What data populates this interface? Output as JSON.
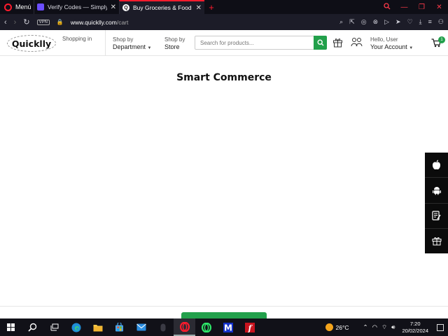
{
  "browser": {
    "menu_label": "Menú",
    "tabs": [
      {
        "title": "Verify Codes — SimplyCodes"
      },
      {
        "title": "Buy Groceries & Food Online"
      }
    ],
    "new_tab_symbol": "+",
    "url_host": "www.quicklly.com",
    "url_path": "/cart",
    "vpn_label": "VPN"
  },
  "site": {
    "logo_text": "Quicklly",
    "shopping_in_label": "Shopping in",
    "shop_by_department": {
      "top": "Shop by",
      "main": "Department"
    },
    "shop_by_store": {
      "top": "Shop by",
      "main": "Store"
    },
    "search": {
      "placeholder": "Search for products..."
    },
    "account": {
      "greeting": "Hello, User",
      "main": "Your Account"
    },
    "cart_count": "1",
    "page_title": "Smart Commerce"
  },
  "side_rail": {
    "items": [
      "apple-icon",
      "android-icon",
      "notepad-icon",
      "gift-icon"
    ]
  },
  "taskbar": {
    "temperature": "26°C",
    "time": "7:20",
    "date": "20/02/2024"
  },
  "colors": {
    "brand_green": "#22a04b",
    "opera_red": "#ff1b2d",
    "browser_dark": "#1c1c28"
  }
}
